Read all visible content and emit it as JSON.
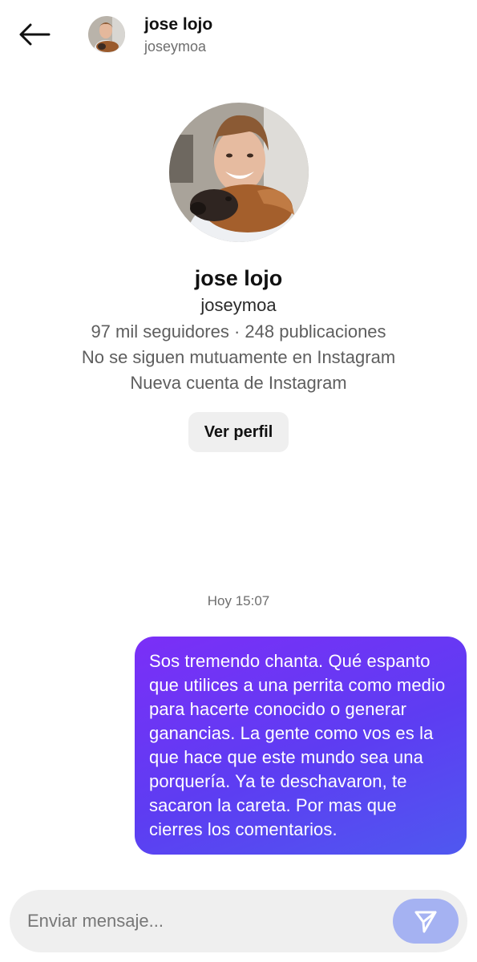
{
  "header": {
    "name": "jose lojo",
    "username": "joseymoa"
  },
  "profile": {
    "name": "jose lojo",
    "username": "joseymoa",
    "stats": "97 mil seguidores · 248 publicaciones",
    "mutual": "No se siguen mutuamente en Instagram",
    "account_status": "Nueva cuenta de Instagram",
    "view_profile_label": "Ver perfil"
  },
  "conversation": {
    "timestamp": "Hoy 15:07",
    "messages": [
      {
        "sender": "me",
        "text": "Sos tremendo chanta. Qué espanto que utilices a una perrita como medio para hacerte conocido o generar ganancias. La gente como vos es la que hace que este mundo sea una porquería. Ya te deschavaron, te sacaron la careta. Por mas que cierres los comentarios."
      }
    ]
  },
  "composer": {
    "placeholder": "Enviar mensaje...",
    "value": ""
  },
  "icons": {
    "back": "arrow-left-icon",
    "send": "send-paper-plane-icon"
  },
  "colors": {
    "bubble_start": "#7b2ff7",
    "bubble_end": "#4f58f0",
    "send_button": "#a5b2f2",
    "secondary_text": "#6e6e6e"
  }
}
